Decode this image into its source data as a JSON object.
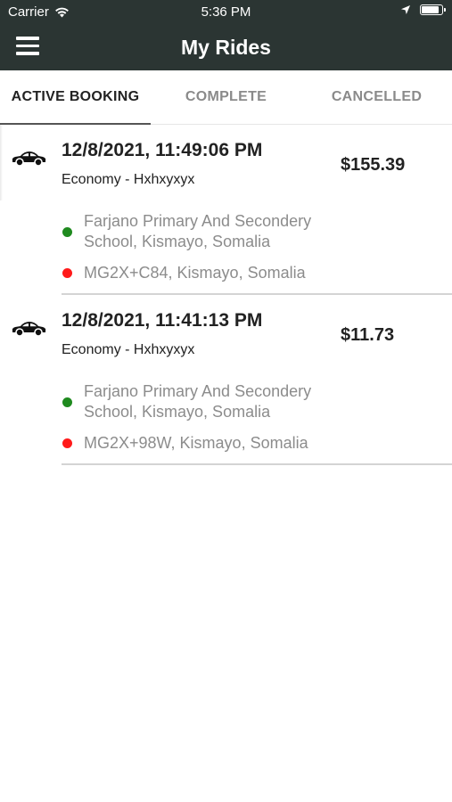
{
  "status_bar": {
    "carrier": "Carrier",
    "time": "5:36 PM",
    "battery_level": 0.9
  },
  "header": {
    "title": "My Rides"
  },
  "tabs": [
    {
      "label": "ACTIVE BOOKING",
      "active": true
    },
    {
      "label": "COMPLETE",
      "active": false
    },
    {
      "label": "CANCELLED",
      "active": false
    }
  ],
  "rides": [
    {
      "datetime": "12/8/2021, 11:49:06 PM",
      "type": "Economy - Hxhxyxyx",
      "price": "$155.39",
      "pickup": "Farjano Primary And Secondery School, Kismayo, Somalia",
      "dropoff": "MG2X+C84, Kismayo, Somalia"
    },
    {
      "datetime": "12/8/2021, 11:41:13 PM",
      "type": "Economy - Hxhxyxyx",
      "price": "$11.73",
      "pickup": "Farjano Primary And Secondery School, Kismayo, Somalia",
      "dropoff": "MG2X+98W, Kismayo, Somalia"
    }
  ],
  "colors": {
    "header_bg": "#2b3533",
    "pickup_dot": "#1f8a1f",
    "dropoff_dot": "#ff1a1a"
  }
}
